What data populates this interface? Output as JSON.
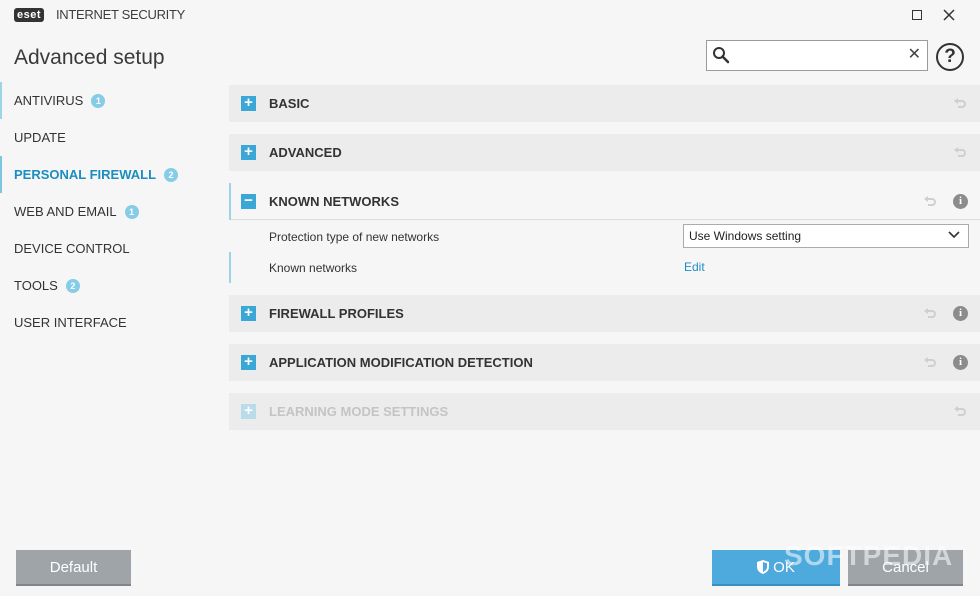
{
  "app": {
    "logo": "eset",
    "product": "INTERNET SECURITY"
  },
  "page_title": "Advanced setup",
  "search": {
    "value": "",
    "placeholder": ""
  },
  "sidebar": {
    "items": [
      {
        "label": "ANTIVIRUS",
        "badge": "1"
      },
      {
        "label": "UPDATE"
      },
      {
        "label": "PERSONAL FIREWALL",
        "badge": "2",
        "active": true
      },
      {
        "label": "WEB AND EMAIL",
        "badge": "1"
      },
      {
        "label": "DEVICE CONTROL"
      },
      {
        "label": "TOOLS",
        "badge": "2"
      },
      {
        "label": "USER INTERFACE"
      }
    ]
  },
  "sections": [
    {
      "title": "BASIC",
      "expanded": false
    },
    {
      "title": "ADVANCED",
      "expanded": false
    },
    {
      "title": "KNOWN NETWORKS",
      "expanded": true,
      "rows": [
        {
          "label": "Protection type of new networks",
          "value": "Use Windows setting"
        },
        {
          "label": "Known networks",
          "link": "Edit"
        }
      ]
    },
    {
      "title": "FIREWALL PROFILES",
      "expanded": false
    },
    {
      "title": "APPLICATION MODIFICATION DETECTION",
      "expanded": false
    },
    {
      "title": "LEARNING MODE SETTINGS",
      "expanded": false,
      "disabled": true
    }
  ],
  "buttons": {
    "default": "Default",
    "ok": "OK",
    "cancel": "Cancel"
  },
  "watermark": "SOFTPEDIA",
  "colors": {
    "accent": "#1b8dbf",
    "button_blue": "#4ea9dc",
    "button_gray": "#9ea4a8",
    "badge": "#86cce7"
  }
}
